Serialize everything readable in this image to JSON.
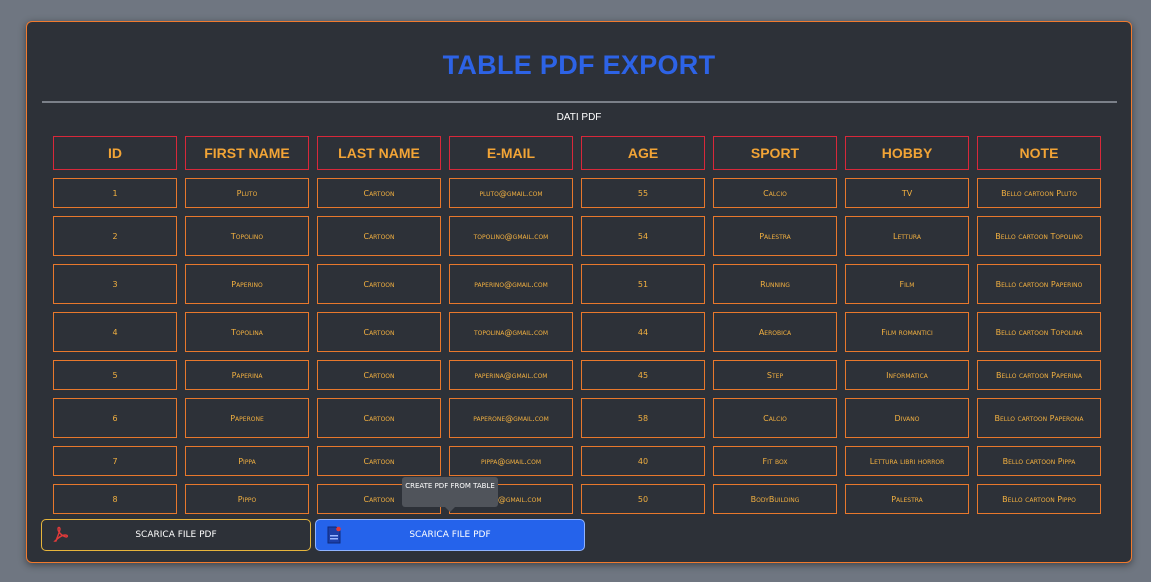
{
  "header": {
    "title": "TABLE PDF EXPORT",
    "subtitle": "DATI PDF"
  },
  "table": {
    "columns": [
      "ID",
      "FIRST NAME",
      "LAST NAME",
      "E-MAIL",
      "AGE",
      "SPORT",
      "HOBBY",
      "NOTE"
    ],
    "rows": [
      [
        "1",
        "Pluto",
        "Cartoon",
        "pluto@gmail.com",
        "55",
        "Calcio",
        "TV",
        "Bello cartoon Pluto"
      ],
      [
        "2",
        "Topolino",
        "Cartoon",
        "topolino@gmail.com",
        "54",
        "Palestra",
        "Lettura",
        "Bello cartoon Topolino"
      ],
      [
        "3",
        "Paperino",
        "Cartoon",
        "paperino@gmail.com",
        "51",
        "Running",
        "Film",
        "Bello cartoon Paperino"
      ],
      [
        "4",
        "Topolina",
        "Cartoon",
        "topolina@gmail.com",
        "44",
        "Aerobica",
        "Film romantici",
        "Bello cartoon Topolina"
      ],
      [
        "5",
        "Paperina",
        "Cartoon",
        "paperina@gmail.com",
        "45",
        "Step",
        "Informatica",
        "Bello cartoon Paperina"
      ],
      [
        "6",
        "Paperone",
        "Cartoon",
        "paperone@gmail.com",
        "58",
        "Calcio",
        "Divano",
        "Bello cartoon Paperona"
      ],
      [
        "7",
        "Pippa",
        "Cartoon",
        "pippa@gmail.com",
        "40",
        "Fit box",
        "Lettura libri horror",
        "Bello cartoon Pippa"
      ],
      [
        "8",
        "Pippo",
        "Cartoon",
        "pippo@gmail.com",
        "50",
        "BodyBuilding",
        "Palestra",
        "Bello cartoon Pippo"
      ]
    ]
  },
  "buttons": {
    "download1": {
      "label": "SCARICA FILE PDF",
      "icon": "pdf-icon",
      "border_color": "#e6b53c"
    },
    "download2": {
      "label": "SCARICA FILE PDF",
      "icon": "pdf-file-icon",
      "background": "#2563eb"
    }
  },
  "tooltip": {
    "text": "CREATE PDF FROM TABLE"
  },
  "colors": {
    "title": "#2d63e6",
    "header_border": "#d8283a",
    "cell_border": "#e8782c",
    "cell_text": "#f2b040",
    "card_border": "#f07a2e"
  }
}
